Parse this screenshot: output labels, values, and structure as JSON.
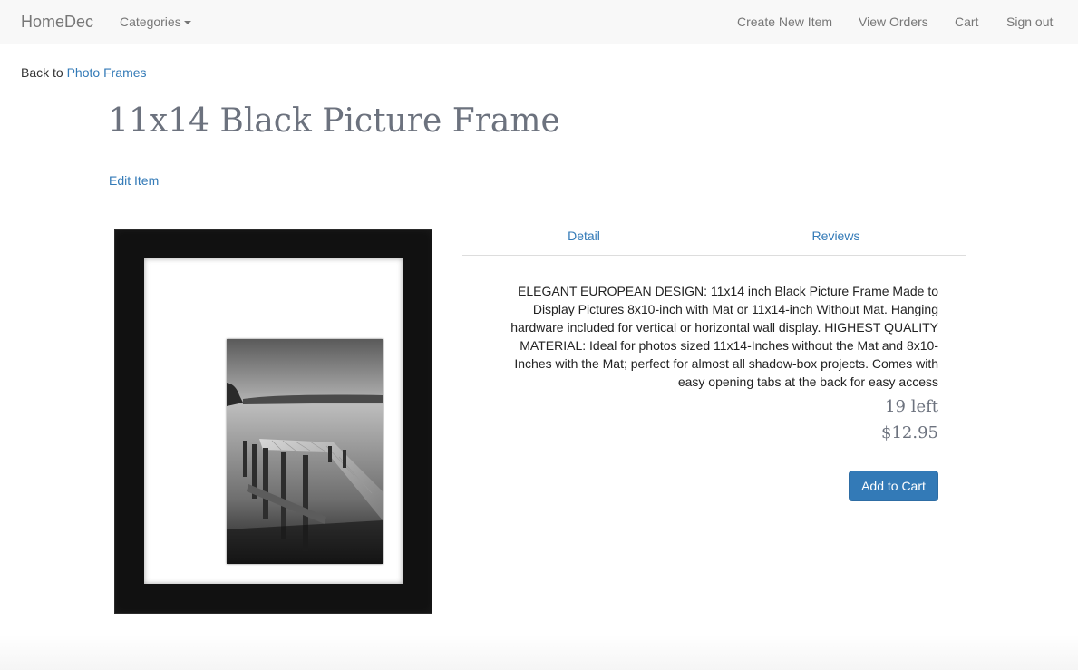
{
  "navbar": {
    "brand": "HomeDec",
    "categories_label": "Categories",
    "right_links": [
      "Create New Item",
      "View Orders",
      "Cart",
      "Sign out"
    ]
  },
  "breadcrumb": {
    "prefix": "Back to",
    "link": "Photo Frames"
  },
  "product": {
    "title": "11x14 Black Picture Frame",
    "edit_label": "Edit Item",
    "tabs": [
      "Detail",
      "Reviews"
    ],
    "description": "ELEGANT EUROPEAN DESIGN: 11x14 inch Black Picture Frame Made to Display Pictures 8x10-inch with Mat or 11x14-inch Without Mat. Hanging hardware included for vertical or horizontal wall display. HIGHEST QUALITY MATERIAL: Ideal for photos sized 11x14-Inches without the Mat and 8x10-Inches with the Mat; perfect for almost all shadow-box projects. Comes with easy opening tabs at the back for easy access",
    "stock": "19 left",
    "price": "$12.95",
    "add_to_cart_label": "Add to Cart"
  },
  "colors": {
    "link": "#337ab7",
    "primary_button": "#337ab7",
    "title_gray": "#6c727e",
    "navbar_bg": "#f8f8f8"
  },
  "icons": [
    "caret-down-icon"
  ]
}
